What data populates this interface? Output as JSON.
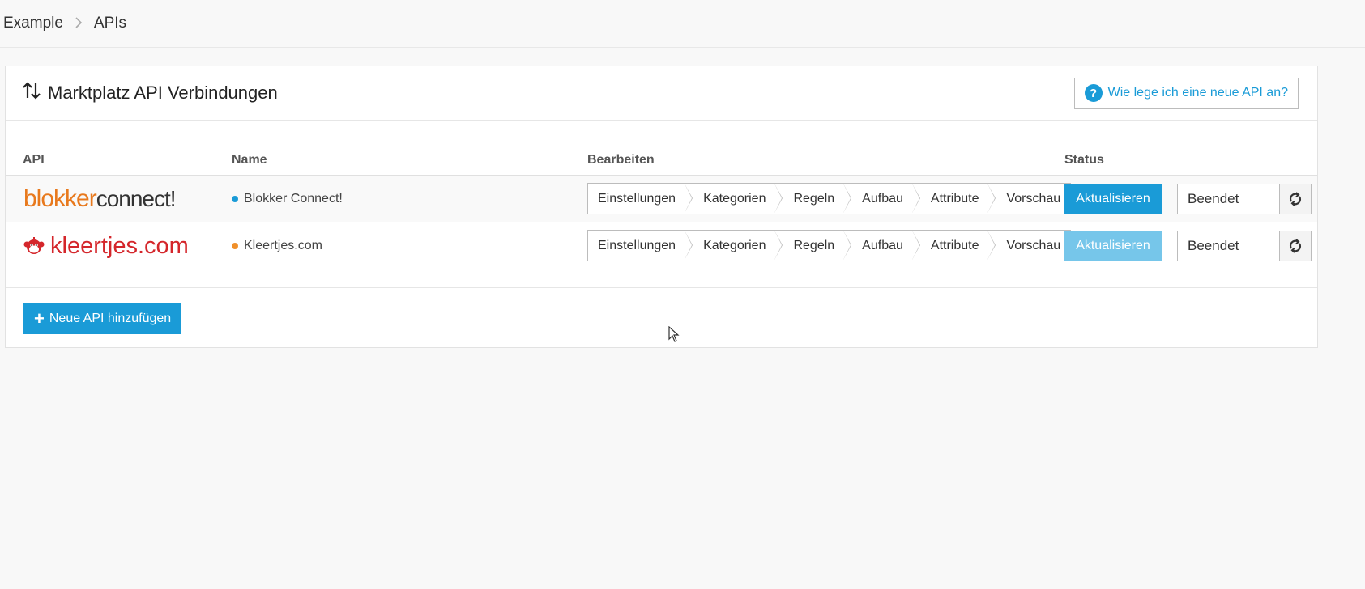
{
  "breadcrumb": {
    "root": "Example",
    "current": "APIs"
  },
  "panel": {
    "title": "Marktplatz API Verbindungen",
    "help_label": "Wie lege ich eine neue API an?"
  },
  "table": {
    "headers": {
      "api": "API",
      "name": "Name",
      "edit": "Bearbeiten",
      "status": "Status"
    },
    "rows": [
      {
        "logo_part1": "blokker",
        "logo_part2": "connect!",
        "name": "Blokker Connect!",
        "dot_color": "#1a9bd7",
        "steps": [
          "Einstellungen",
          "Kategorien",
          "Regeln",
          "Aufbau",
          "Attribute",
          "Vorschau"
        ],
        "update_label": "Aktualisieren",
        "status_value": "Beendet"
      },
      {
        "logo_part1": "kleertjes.com",
        "name": "Kleertjes.com",
        "dot_color": "#f0902a",
        "steps": [
          "Einstellungen",
          "Kategorien",
          "Regeln",
          "Aufbau",
          "Attribute",
          "Vorschau"
        ],
        "update_label": "Aktualisieren",
        "status_value": "Beendet"
      }
    ]
  },
  "footer": {
    "add_label": "Neue API hinzufügen"
  },
  "colors": {
    "accent": "#1a9bd7",
    "accent_disabled": "#76c6ea",
    "blokker_orange": "#e8791d",
    "kleertjes_red": "#d4262b"
  },
  "icons": {
    "sort": "sort-arrows-icon",
    "help": "question-circle-icon",
    "refresh": "refresh-icon",
    "add": "plus-icon"
  }
}
